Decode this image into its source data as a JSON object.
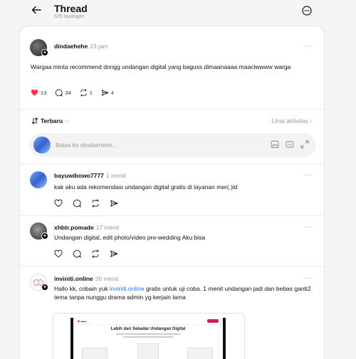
{
  "header": {
    "title": "Thread",
    "views": "625 tayangan",
    "back_icon": "arrow-left-icon",
    "more_icon": "ellipsis-circle-icon"
  },
  "main_post": {
    "author": "dindaehehe",
    "time": "23 jam",
    "text": "Wargaa minta recommend dongg undangan digital yang baguss dimaanaaaa maaciwwww warga",
    "likes": "13",
    "comments": "34",
    "reposts": "1",
    "shares": "4"
  },
  "sort": {
    "label": "Terbaru",
    "activity_link": "Lihat aktivitas"
  },
  "reply_box": {
    "placeholder": "Balas ke dindaehehe..."
  },
  "replies": [
    {
      "author": "bayuwibowo7777",
      "time": "1 menit",
      "text": "kak aku ada rekomendasi undangan digital gratis di layanan mer(.)id"
    },
    {
      "author": "xhbtr.pomade",
      "time": "17 menit",
      "text": "Undangan digital, edit photo/video pre-wedding Aku bisa"
    },
    {
      "author": "inviniti.online",
      "time": "26 menit",
      "text_before": "Hallo kk, cobain yuk ",
      "link": "inviniti.online",
      "text_after": " gratis untuk uji coba. 1 menit undangan jadi dan bebas ganti2 tema tanpa nunggu drama admin yg kerjain lama",
      "preview_heading": "Lebih dari Sekadar Undangan Digital"
    }
  ],
  "colors": {
    "like_red": "#ff3040",
    "link_blue": "#1a73e8",
    "muted": "#9a9a9a"
  }
}
